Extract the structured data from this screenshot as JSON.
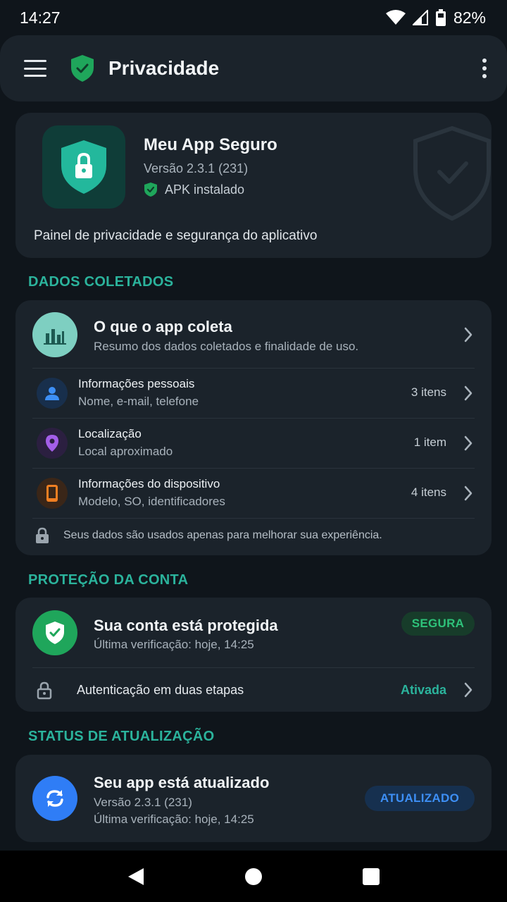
{
  "status_bar": {
    "time": "14:27",
    "battery": "82%"
  },
  "app_bar": {
    "title": "Privacidade"
  },
  "hero": {
    "app_name": "Meu App Seguro",
    "version": "Versão 2.3.1 (231)",
    "install_status": "APK instalado",
    "description": "Painel de privacidade e segurança do aplicativo"
  },
  "sections": {
    "data_collected": "DADOS COLETADOS",
    "account_protection": "PROTEÇÃO DA CONTA",
    "update_status": "STATUS DE ATUALIZAÇÃO"
  },
  "collect": {
    "title": "O que o app coleta",
    "subtitle": "Resumo dos dados coletados e finalidade de uso.",
    "items": [
      {
        "label": "Informações pessoais",
        "detail": "Nome, e-mail, telefone",
        "count": "3 itens",
        "icon": "person-icon",
        "color": "#3d8ff5"
      },
      {
        "label": "Localização",
        "detail": "Local aproximado",
        "count": "1 item",
        "icon": "location-pin-icon",
        "color": "#a35ee8"
      },
      {
        "label": "Informações do dispositivo",
        "detail": "Modelo, SO, identificadores",
        "count": "4 itens",
        "icon": "phone-icon",
        "color": "#f07f22"
      }
    ],
    "footnote": "Seus dados são usados apenas para melhorar sua experiência."
  },
  "protection": {
    "title": "Sua conta está protegida",
    "last_check": "Última verificação: hoje, 14:25",
    "badge": "SEGURA",
    "two_factor_label": "Autenticação em duas etapas",
    "two_factor_status": "Ativada"
  },
  "update": {
    "title": "Seu app está atualizado",
    "version": "Versão 2.3.1 (231)",
    "last_check": "Última verificação: hoje, 14:25",
    "badge": "ATUALIZADO"
  },
  "colors": {
    "accent": "#2bb39c",
    "safe_green": "#2ec27a",
    "update_blue": "#3d8ff5",
    "card_bg": "#1b232b",
    "page_bg": "#0f151b"
  }
}
